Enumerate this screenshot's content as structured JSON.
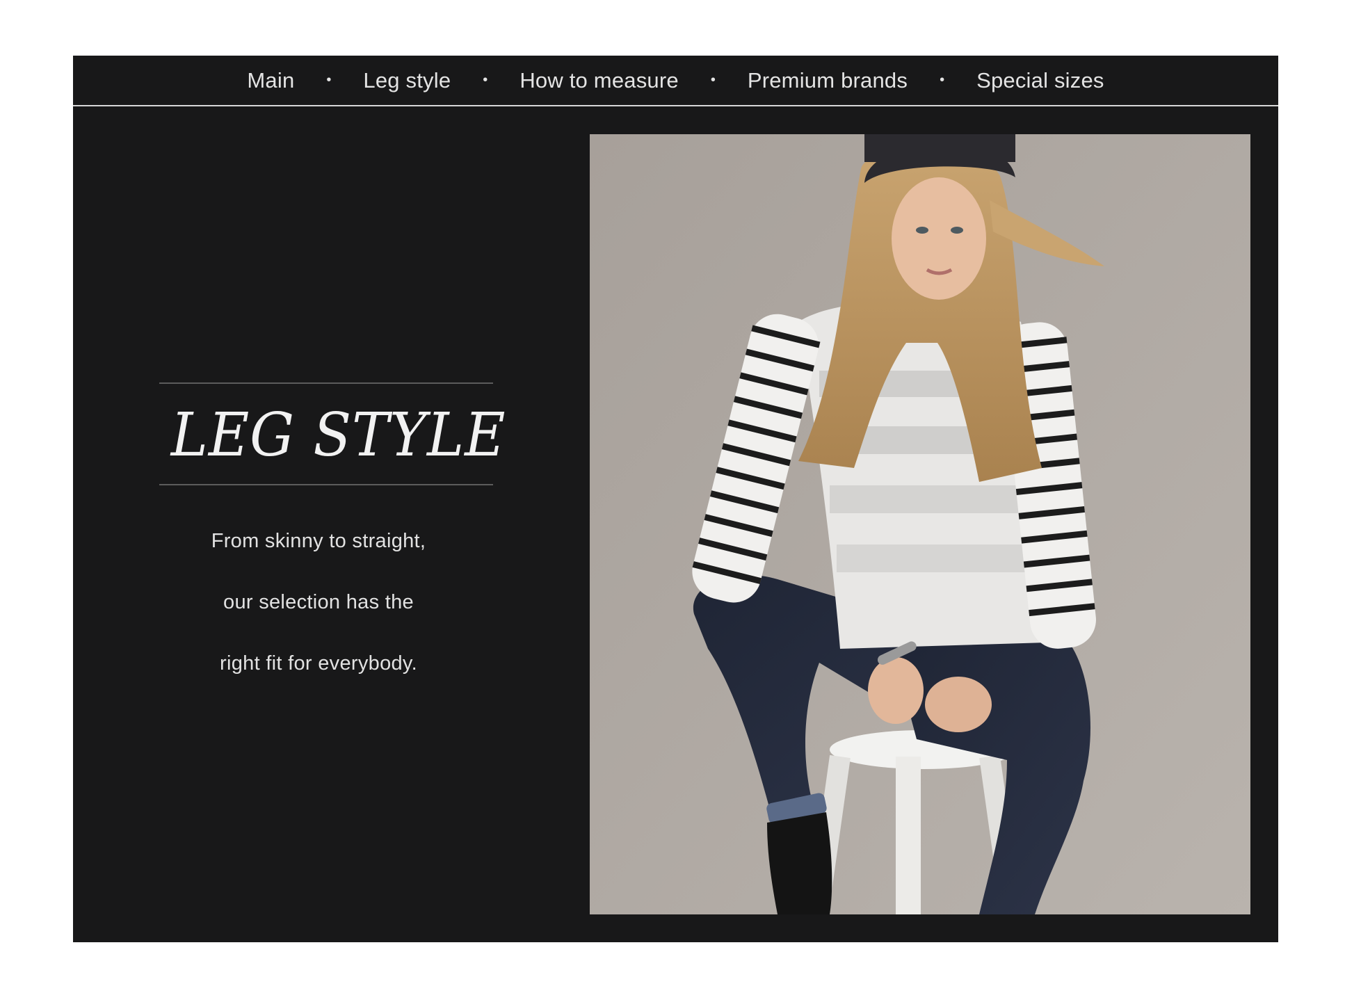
{
  "nav": {
    "items": [
      {
        "label": "Main"
      },
      {
        "label": "Leg style"
      },
      {
        "label": "How to measure"
      },
      {
        "label": "Premium brands"
      },
      {
        "label": "Special sizes"
      }
    ],
    "separator": "•"
  },
  "section": {
    "title": "LEG STYLE",
    "body_lines": [
      "From skinny to straight,",
      "our selection has the",
      "right fit for everybody."
    ]
  },
  "colors": {
    "page_background": "#ffffff",
    "panel_background": "#181819",
    "text": "#e4e4e4",
    "photo_backdrop": "#aaa49e"
  },
  "photo": {
    "icon": "model-photo"
  }
}
